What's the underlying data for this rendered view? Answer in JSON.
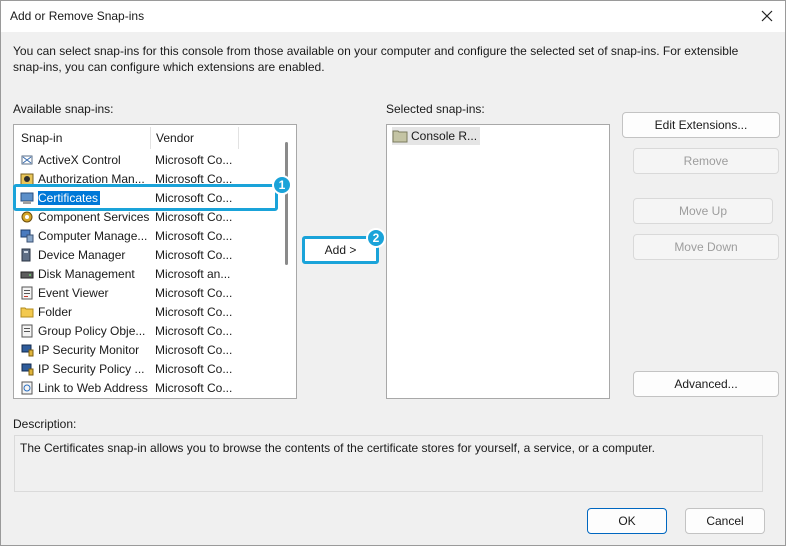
{
  "window": {
    "title": "Add or Remove Snap-ins"
  },
  "intro": "You can select snap-ins for this console from those available on your computer and configure the selected set of snap-ins. For extensible snap-ins, you can configure which extensions are enabled.",
  "available": {
    "label": "Available snap-ins:",
    "columns": [
      "Snap-in",
      "Vendor"
    ],
    "items": [
      {
        "name": "ActiveX Control",
        "vendor": "Microsoft Co...",
        "icon": "activex-icon"
      },
      {
        "name": "Authorization Man...",
        "vendor": "Microsoft Co...",
        "icon": "authorization-icon"
      },
      {
        "name": "Certificates",
        "vendor": "Microsoft Co...",
        "icon": "certificates-icon",
        "selected": true
      },
      {
        "name": "Component Services",
        "vendor": "Microsoft Co...",
        "icon": "component-services-icon"
      },
      {
        "name": "Computer Manage...",
        "vendor": "Microsoft Co...",
        "icon": "computer-management-icon"
      },
      {
        "name": "Device Manager",
        "vendor": "Microsoft Co...",
        "icon": "device-manager-icon"
      },
      {
        "name": "Disk Management",
        "vendor": "Microsoft an...",
        "icon": "disk-management-icon"
      },
      {
        "name": "Event Viewer",
        "vendor": "Microsoft Co...",
        "icon": "event-viewer-icon"
      },
      {
        "name": "Folder",
        "vendor": "Microsoft Co...",
        "icon": "folder-icon"
      },
      {
        "name": "Group Policy Obje...",
        "vendor": "Microsoft Co...",
        "icon": "group-policy-icon"
      },
      {
        "name": "IP Security Monitor",
        "vendor": "Microsoft Co...",
        "icon": "ip-security-monitor-icon"
      },
      {
        "name": "IP Security Policy ...",
        "vendor": "Microsoft Co...",
        "icon": "ip-security-policy-icon"
      },
      {
        "name": "Link to Web Address",
        "vendor": "Microsoft Co...",
        "icon": "link-web-icon"
      }
    ]
  },
  "selected": {
    "label": "Selected snap-ins:",
    "items": [
      {
        "name": "Console R...",
        "icon": "console-root-folder-icon"
      }
    ]
  },
  "buttons": {
    "add": "Add >",
    "edit_extensions": "Edit Extensions...",
    "remove": "Remove",
    "move_up": "Move Up",
    "move_down": "Move Down",
    "advanced": "Advanced...",
    "ok": "OK",
    "cancel": "Cancel"
  },
  "description": {
    "label": "Description:",
    "text": "The Certificates snap-in allows you to browse the contents of the certificate stores for yourself, a service, or a computer."
  },
  "annotations": {
    "step1": "1",
    "step2": "2"
  },
  "colors": {
    "highlight": "#1aa3d9",
    "selection": "#0078d7"
  }
}
